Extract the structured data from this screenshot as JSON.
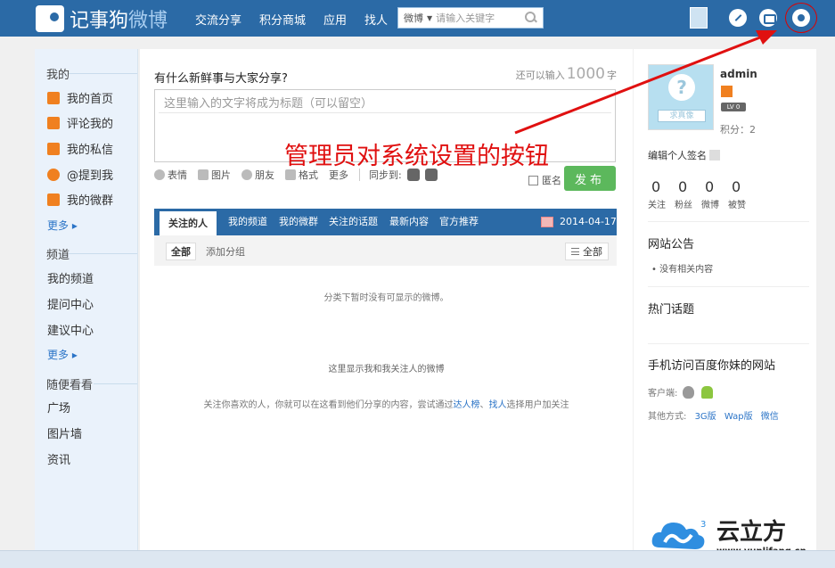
{
  "header": {
    "logo_main": "记事狗",
    "logo_accent": "微博",
    "nav": [
      "交流分享",
      "积分商城",
      "应用",
      "找人"
    ],
    "search": {
      "scope": "微博",
      "placeholder": "请输入关键字"
    },
    "accent_color": "#2b6aa6"
  },
  "sidebar": {
    "section_mine": "我的",
    "mine_items": [
      {
        "label": "我的首页",
        "icon": "home-icon",
        "color": "#f08020"
      },
      {
        "label": "评论我的",
        "icon": "comment-icon",
        "color": "#f08020"
      },
      {
        "label": "我的私信",
        "icon": "message-icon",
        "color": "#f08020"
      },
      {
        "label": "@提到我",
        "icon": "mention-icon",
        "color": "#f08020"
      },
      {
        "label": "我的微群",
        "icon": "group-icon",
        "color": "#f08020"
      }
    ],
    "more1": "更多 ▸",
    "section_channel": "频道",
    "channel_items": [
      "我的频道",
      "提问中心",
      "建议中心"
    ],
    "more2": "更多 ▸",
    "section_browse": "随便看看",
    "browse_items": [
      "广场",
      "图片墙",
      "资讯"
    ]
  },
  "composer": {
    "title": "有什么新鲜事与大家分享?",
    "remain_prefix": "还可以输入",
    "remain_num": "1000",
    "remain_suffix": "字",
    "title_placeholder": "这里输入的文字将成为标题（可以留空）",
    "tools": [
      "表情",
      "图片",
      "朋友",
      "格式",
      "更多"
    ],
    "sync_label": "同步到:",
    "anonymous_label": "匿名",
    "publish_label": "发布"
  },
  "annotation": {
    "text": "管理员对系统设置的按钮",
    "color": "#e01010"
  },
  "feed": {
    "tabs": [
      "关注的人",
      "我的频道",
      "我的微群",
      "关注的话题",
      "最新内容",
      "官方推荐"
    ],
    "active_tab": "关注的人",
    "date": "2014-04-17",
    "sub_all": "全部",
    "sub_add": "添加分组",
    "filter": "全部",
    "empty_group": "分类下暂时没有可显示的微博。",
    "empty_title": "这里显示我和我关注人的微博",
    "empty_hint_prefix": "关注你喜欢的人，你就可以在这看到他们分享的内容，尝试通过",
    "link1": "达人榜",
    "sep": "、",
    "link2": "找人",
    "empty_hint_suffix": "选择用户加关注"
  },
  "profile": {
    "avatar_plate": "求真像",
    "name": "admin",
    "level": "LV 0",
    "points": "积分：2",
    "sign": "编辑个人签名",
    "stats": [
      {
        "n": "0",
        "l": "关注"
      },
      {
        "n": "0",
        "l": "粉丝"
      },
      {
        "n": "0",
        "l": "微博"
      },
      {
        "n": "0",
        "l": "被赞"
      }
    ]
  },
  "right": {
    "notice_title": "网站公告",
    "notice_item": "• 没有相关内容",
    "hot_title": "热门话题",
    "mobile_title": "手机访问百度你妹的网站",
    "client_label": "客户端:",
    "other_label": "其他方式:",
    "other_links": [
      "3G版",
      "Wap版",
      "微信"
    ]
  },
  "watermark": {
    "name": "云立方",
    "sup": "3",
    "url": "www.yunlifang.cn"
  }
}
